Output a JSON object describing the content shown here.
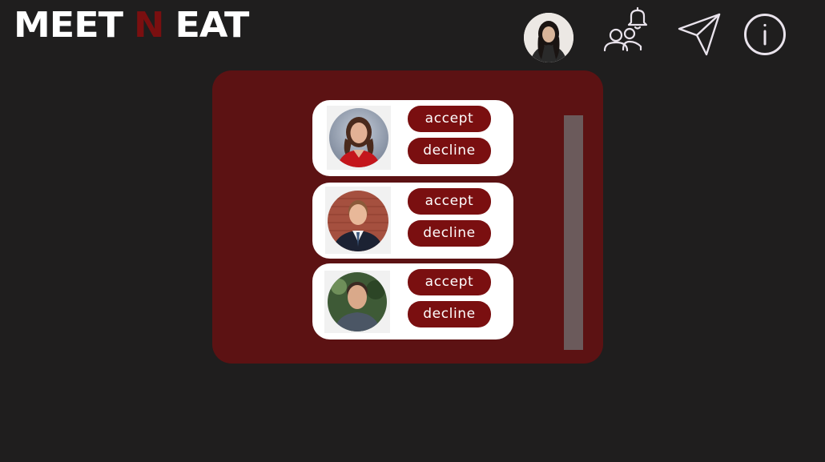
{
  "header": {
    "logo": {
      "word1": "MEET",
      "word2": "N",
      "word3": "EAT"
    },
    "icons": [
      "profile-avatar",
      "group-notifications-icon",
      "send-icon",
      "info-icon"
    ]
  },
  "requests": [
    {
      "accept_label": "accept",
      "decline_label": "decline"
    },
    {
      "accept_label": "accept",
      "decline_label": "decline"
    },
    {
      "accept_label": "accept",
      "decline_label": "decline"
    }
  ],
  "colors": {
    "background": "#1f1e1e",
    "panel": "#5c1213",
    "accent": "#7a0f10",
    "scrollbar": "#6b5a5b",
    "icon_stroke": "#e9e3ec"
  }
}
